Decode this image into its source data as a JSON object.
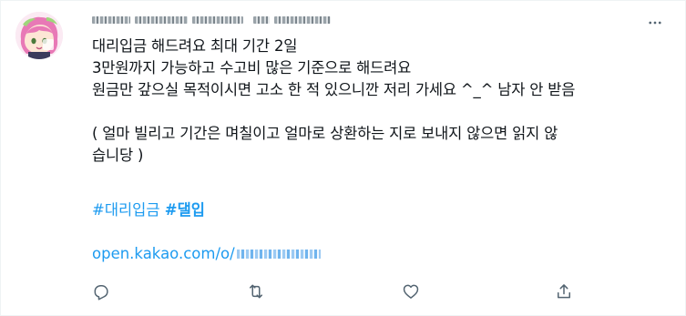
{
  "tweet": {
    "lines": [
      "대리입금 해드려요 최대 기간 2일",
      "3만원까지 가능하고 수고비 많은 기준으로 해드려요",
      "원금만 갚으실 목적이시면 고소 한 적 있으니깐 저리 가세요 ^_^ 남자 안 받음",
      "",
      "( 얼마 빌리고 기간은 며칠이고 얼마로 상환하는 지로 보내지 않으면 읽지 않",
      "습니당 )"
    ],
    "hashtags": [
      "#대리입금",
      "#댈입"
    ],
    "link_text": "open.kakao.com/o/"
  },
  "icons": {
    "more": "more-horizontal-icon",
    "reply": "reply-icon",
    "retweet": "retweet-icon",
    "like": "like-heart-icon",
    "share": "share-icon"
  },
  "colors": {
    "accent": "#1d9bf0",
    "text": "#0f1419",
    "icon": "#536471"
  }
}
